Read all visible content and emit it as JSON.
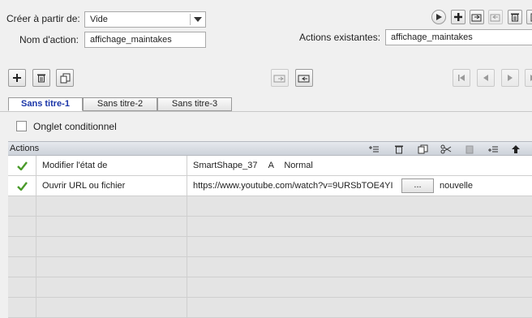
{
  "top": {
    "create_from_label": "Créer à partir de:",
    "create_from_value": "Vide",
    "action_name_label": "Nom d'action:",
    "action_name_value": "affichage_maintakes",
    "existing_actions_label": "Actions existantes:",
    "existing_actions_value": "affichage_maintakes"
  },
  "tabs": [
    {
      "label": "Sans titre-1",
      "active": true
    },
    {
      "label": "Sans titre-2",
      "active": false
    },
    {
      "label": "Sans titre-3",
      "active": false
    }
  ],
  "conditional_tab_label": "Onglet conditionnel",
  "actions_header": "Actions",
  "rows": [
    {
      "action": "Modifier l'état de",
      "target": "SmartShape_37",
      "field2": "A",
      "field3": "Normal"
    },
    {
      "action": "Ouvrir URL ou fichier",
      "url": "https://www.youtube.com/watch?v=9URSbTOE4YI",
      "browse_label": "...",
      "window": "nouvelle"
    }
  ],
  "colors": {
    "check": "#4a9a2a",
    "active_tab_text": "#1a35a8"
  }
}
